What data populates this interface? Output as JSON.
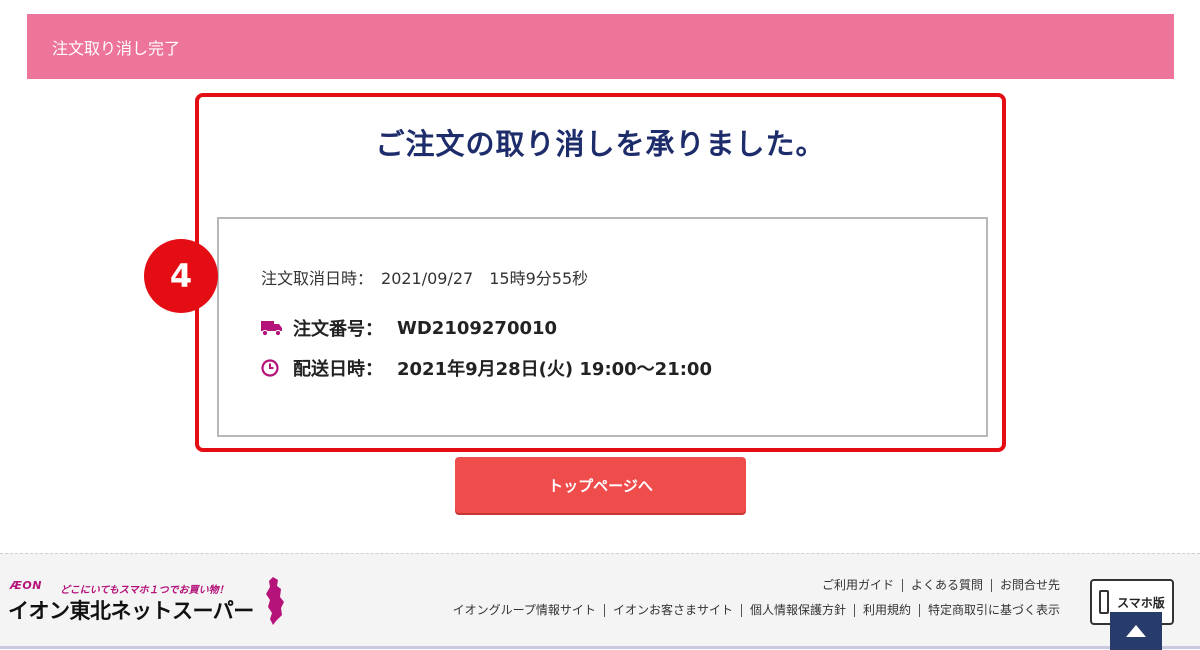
{
  "header": {
    "title": "注文取り消し完了"
  },
  "main": {
    "heading": "ご注文の取り消しを承りました。",
    "step_number": "4",
    "cancel_label": "注文取消日時：",
    "cancel_value": "2021/09/27　15時9分55秒",
    "order_label": "注文番号：",
    "order_value": "WD2109270010",
    "delivery_label": "配送日時：",
    "delivery_value": "2021年9月28日(火) 19:00～21:00",
    "icons": {
      "order": "truck-icon",
      "delivery": "clock-icon"
    },
    "top_button": "トップページへ"
  },
  "footer": {
    "logo_brand": "ÆON",
    "logo_tagline": "どこにいてもスマホ１つでお買い物！",
    "logo_name": "イオン東北ネットスーパー",
    "links_row1": [
      "ご利用ガイド",
      "よくある質問",
      "お問合せ先"
    ],
    "links_row2": [
      "イオングループ情報サイト",
      "イオンお客さまサイト",
      "個人情報保護方針",
      "利用規約",
      "特定商取引に基づく表示"
    ],
    "mobile_label": "スマホ版"
  },
  "colors": {
    "header_bg": "#ed7599",
    "heading": "#1d2c6a",
    "highlight": "#e50d14",
    "accent_icon": "#b5127a",
    "button": "#ef4c4c",
    "pagetop": "#283c6c"
  }
}
